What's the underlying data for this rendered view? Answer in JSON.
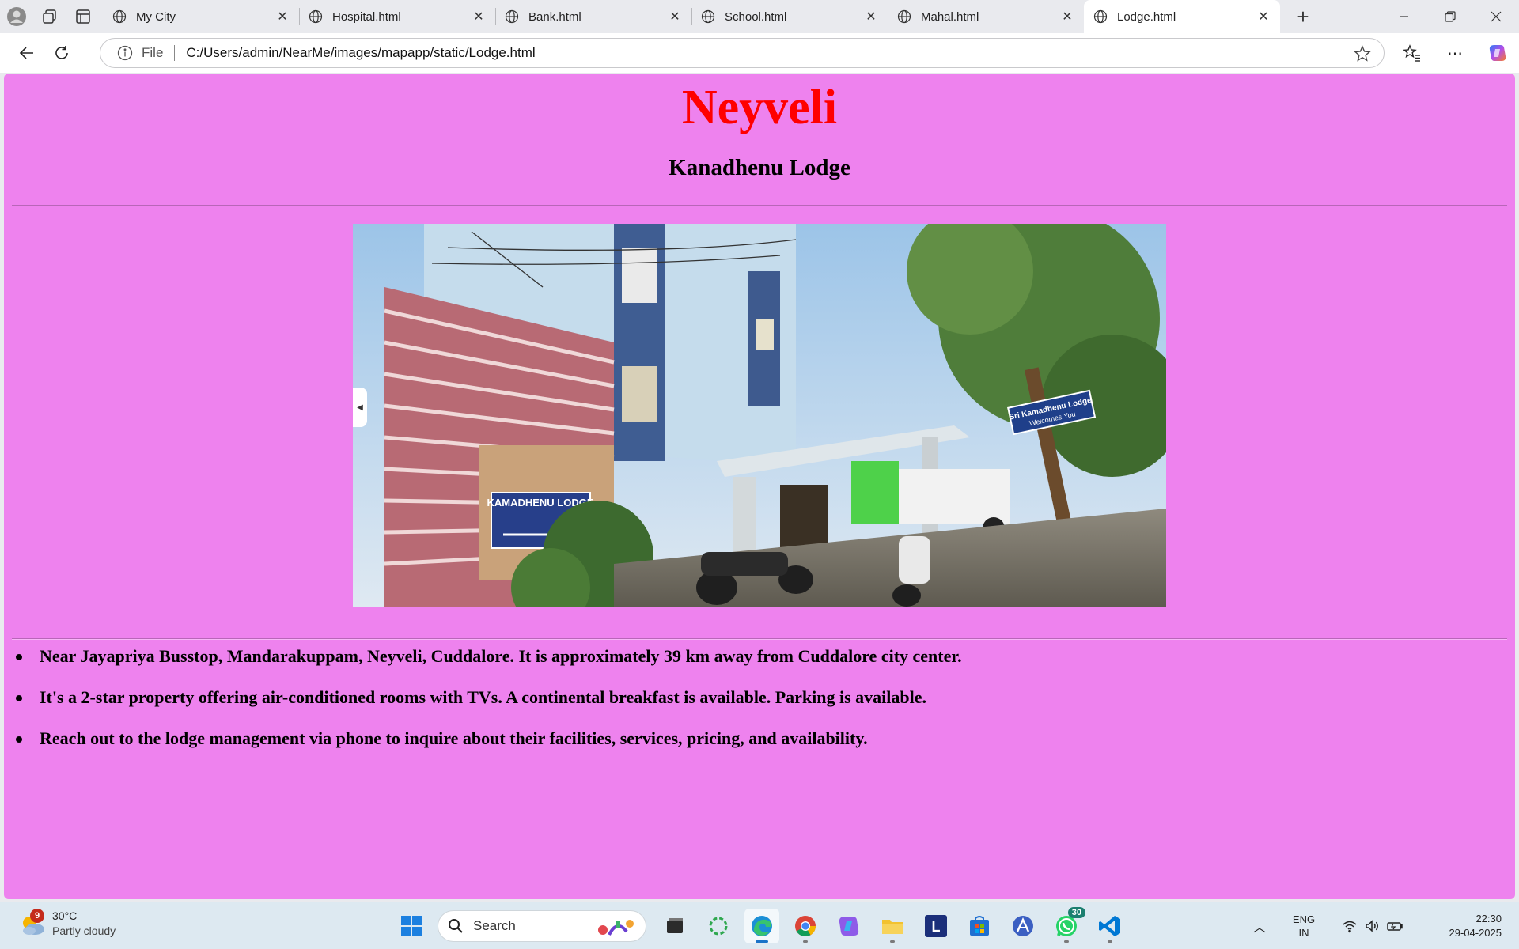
{
  "browser": {
    "tabs": [
      {
        "title": "My City"
      },
      {
        "title": "Hospital.html"
      },
      {
        "title": "Bank.html"
      },
      {
        "title": "School.html"
      },
      {
        "title": "Mahal.html"
      },
      {
        "title": "Lodge.html",
        "active": true
      }
    ],
    "address": {
      "scheme_label": "File",
      "url": "C:/Users/admin/NearMe/images/mapapp/static/Lodge.html"
    }
  },
  "page": {
    "background_color": "#ee82ee",
    "title": "Neyveli",
    "title_color": "#ff0000",
    "subtitle": "Kanadhenu Lodge",
    "image_sign_text": [
      "KAMADHENU LODGE",
      "Sri Kamadhenu Lodge",
      "Welcomes You"
    ],
    "facts": [
      "Near Jayapriya Busstop, Mandarakuppam, Neyveli, Cuddalore. It is approximately 39 km away from Cuddalore city center.",
      "It's a 2-star property offering air-conditioned rooms with TVs. A continental breakfast is available. Parking is available.",
      "Reach out to the lodge management via phone to inquire about their facilities, services, pricing, and availability."
    ]
  },
  "taskbar": {
    "weather": {
      "temp": "30°C",
      "condition": "Partly cloudy",
      "badge": "9"
    },
    "search_label": "Search",
    "apps": [
      "start-icon",
      "search",
      "file-explorer-icon",
      "edge-icon",
      "chrome-icon",
      "copilot-icon",
      "folder-icon",
      "l-app-icon",
      "store-icon",
      "arc-app-icon",
      "whatsapp-icon",
      "vscode-icon"
    ],
    "whatsapp_badge": "30",
    "language": {
      "line1": "ENG",
      "line2": "IN"
    },
    "time": "22:30",
    "date": "29-04-2025"
  }
}
